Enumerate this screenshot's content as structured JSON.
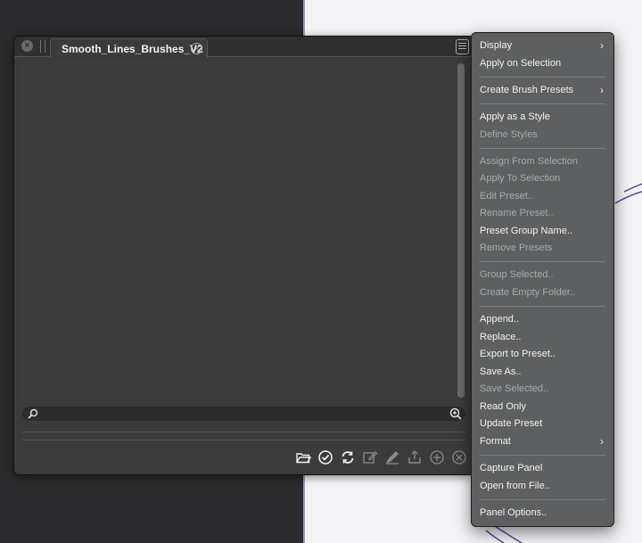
{
  "panel": {
    "tab_title": "Smooth_Lines_Brushes_V2",
    "close_glyph": "×",
    "tab_close_glyph": "×",
    "toolbar_icons": [
      "folder-open-icon",
      "checkmark-icon",
      "refresh-icon",
      "edit-icon",
      "brush-edit-icon",
      "export-icon",
      "add-icon",
      "remove-icon"
    ]
  },
  "menu": {
    "items": [
      {
        "label": "Display",
        "enabled": true,
        "submenu": true
      },
      {
        "label": "Apply on Selection",
        "enabled": true
      },
      {
        "label": "Create Brush Presets",
        "enabled": true,
        "submenu": true
      },
      {
        "label": "Apply as a Style",
        "enabled": true
      },
      {
        "label": "Define Styles",
        "enabled": false
      },
      {
        "label": "Assign From Selection",
        "enabled": false
      },
      {
        "label": "Apply To Selection",
        "enabled": false
      },
      {
        "label": "Edit Preset..",
        "enabled": false
      },
      {
        "label": "Rename Preset..",
        "enabled": false
      },
      {
        "label": "Preset Group Name..",
        "enabled": true
      },
      {
        "label": "Remove Presets",
        "enabled": false
      },
      {
        "label": "Group Selected..",
        "enabled": false
      },
      {
        "label": "Create Empty Folder..",
        "enabled": false
      },
      {
        "label": "Append..",
        "enabled": true
      },
      {
        "label": "Replace..",
        "enabled": true
      },
      {
        "label": "Export to Preset..",
        "enabled": true
      },
      {
        "label": "Save As..",
        "enabled": true
      },
      {
        "label": "Save Selected..",
        "enabled": false
      },
      {
        "label": "Read Only",
        "enabled": true
      },
      {
        "label": "Update Preset",
        "enabled": true
      },
      {
        "label": "Format",
        "enabled": true,
        "submenu": true
      },
      {
        "label": "Capture Panel",
        "enabled": true
      },
      {
        "label": "Open from File..",
        "enabled": true
      },
      {
        "label": "Panel Options..",
        "enabled": true
      }
    ],
    "chevron": "›"
  }
}
